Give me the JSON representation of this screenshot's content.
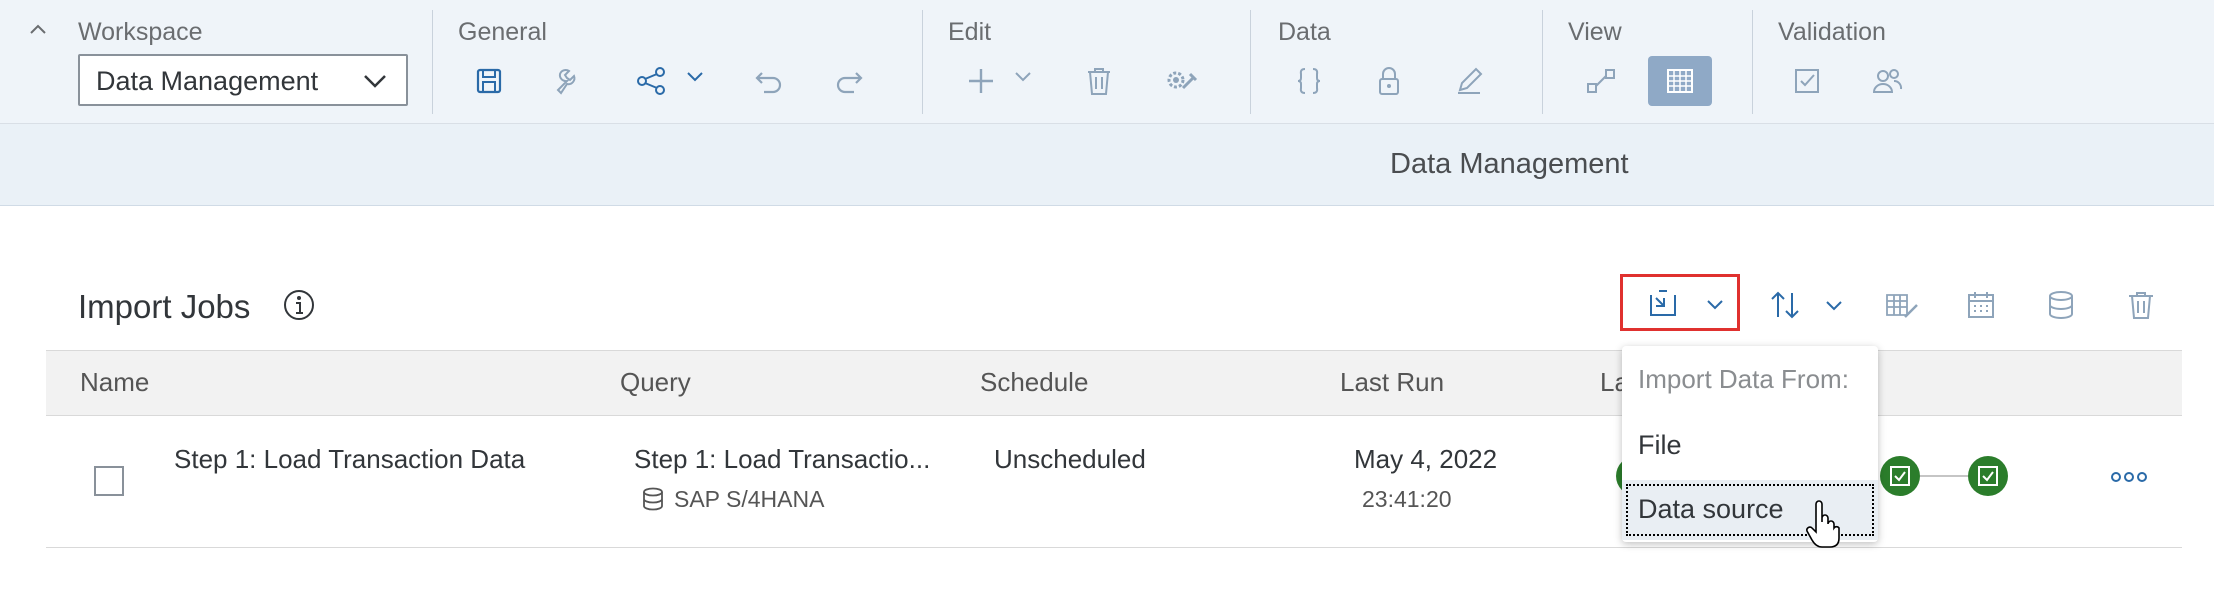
{
  "toolbar": {
    "workspace": {
      "label": "Workspace",
      "selected": "Data Management"
    },
    "groups": {
      "general": "General",
      "edit": "Edit",
      "data": "Data",
      "view": "View",
      "validation": "Validation"
    }
  },
  "page_title": "Data Management",
  "section": {
    "title": "Import Jobs"
  },
  "table": {
    "columns": [
      "Name",
      "Query",
      "Schedule",
      "Last Run",
      "La"
    ],
    "rows": [
      {
        "name": "Step 1: Load Transaction Data",
        "query": "Step 1: Load Transactio...",
        "source": "SAP S/4HANA",
        "schedule": "Unscheduled",
        "last_run_date": "May 4, 2022",
        "last_run_time": "23:41:20"
      }
    ]
  },
  "import_menu": {
    "header": "Import Data From:",
    "items": [
      "File",
      "Data source"
    ]
  },
  "colors": {
    "accent": "#0a6ed1",
    "highlight": "#e0312f",
    "success": "#2b7d2b",
    "toolbar_bg": "#eff4f9"
  }
}
